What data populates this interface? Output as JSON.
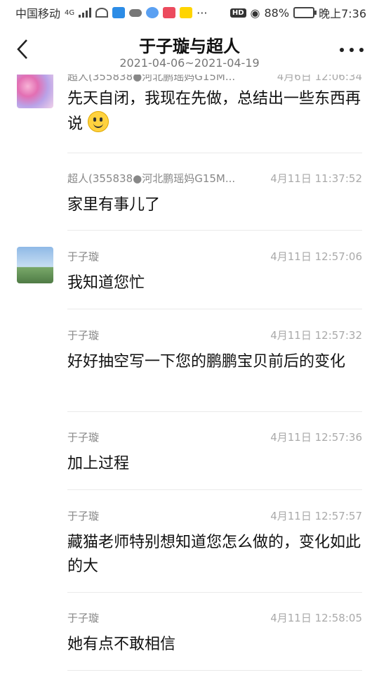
{
  "status_bar": {
    "carrier": "中国移动",
    "network": "4G",
    "battery": "88%",
    "time": "晚上7:36",
    "hd_label": "HD",
    "more_indicator": "···"
  },
  "header": {
    "title": "于子璇与超人",
    "date_range": "2021-04-06~2021-04-19"
  },
  "messages": [
    {
      "sender": "超人(355838●河北鹏瑶妈G15M...",
      "time": "4月6日 12:06:34",
      "text": "先天自闭，我现在先做，总结出一些东西再说",
      "avatar": "flowers"
    },
    {
      "sender": "超人(355838●河北鹏瑶妈G15M...",
      "time": "4月11日 11:37:52",
      "text": "家里有事儿了"
    },
    {
      "sender": "于子璇",
      "time": "4月11日 12:57:06",
      "text": "我知道您忙",
      "avatar": "city"
    },
    {
      "sender": "于子璇",
      "time": "4月11日 12:57:32",
      "text": "好好抽空写一下您的鹏鹏宝贝前后的变化"
    },
    {
      "sender": "于子璇",
      "time": "4月11日 12:57:36",
      "text": "加上过程"
    },
    {
      "sender": "于子璇",
      "time": "4月11日 12:57:57",
      "text": "藏猫老师特别想知道您怎么做的，变化如此的大"
    },
    {
      "sender": "于子璇",
      "time": "4月11日 12:58:05",
      "text": "她有点不敢相信"
    }
  ],
  "colors": {
    "accent_text": "#111111",
    "muted_text": "#888888",
    "time_text": "#aaaaaa"
  }
}
